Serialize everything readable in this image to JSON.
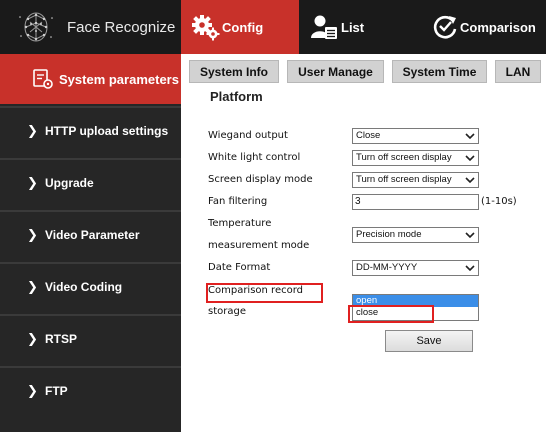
{
  "header": {
    "brand": "Face Recognize",
    "tabs": [
      {
        "label": "Config",
        "icon": "gears-icon",
        "active": true
      },
      {
        "label": "List",
        "icon": "user-list-icon",
        "active": false
      },
      {
        "label": "Comparison",
        "icon": "comparison-refresh-icon",
        "active": false
      }
    ]
  },
  "sidebar": {
    "active": {
      "label": "System parameters",
      "icon": "settings-document-icon"
    },
    "items": [
      {
        "label": "HTTP upload settings"
      },
      {
        "label": "Upgrade"
      },
      {
        "label": "Video Parameter"
      },
      {
        "label": "Video Coding"
      },
      {
        "label": "RTSP"
      },
      {
        "label": "FTP"
      }
    ]
  },
  "subtabs": [
    "System Info",
    "User Manage",
    "System Time",
    "LAN"
  ],
  "section_title": "Platform",
  "form": {
    "wiegand": {
      "label": "Wiegand output",
      "value": "Close"
    },
    "white_light": {
      "label": "White light control",
      "value": "Turn off screen display"
    },
    "screen_mode": {
      "label": "Screen display mode",
      "value": "Turn off screen display"
    },
    "fan": {
      "label": "Fan filtering",
      "value": "3",
      "hint": "(1-10s)"
    },
    "temp_mode": {
      "label_line1": "Temperature",
      "label_line2": "measurement mode",
      "value": "Precision mode"
    },
    "date_format": {
      "label": "Date Format",
      "value": "DD-MM-YYYY"
    },
    "comparison_storage": {
      "label_line1": "Comparison record",
      "label_line2": "storage",
      "options": [
        "open",
        "close"
      ],
      "highlighted": "open"
    }
  },
  "save_label": "Save",
  "colors": {
    "accent": "#c8312a",
    "header_bg": "#1a1a1a",
    "sidebar_bg": "#262626",
    "highlight": "#3b8ee8",
    "annotation": "#e02020"
  }
}
